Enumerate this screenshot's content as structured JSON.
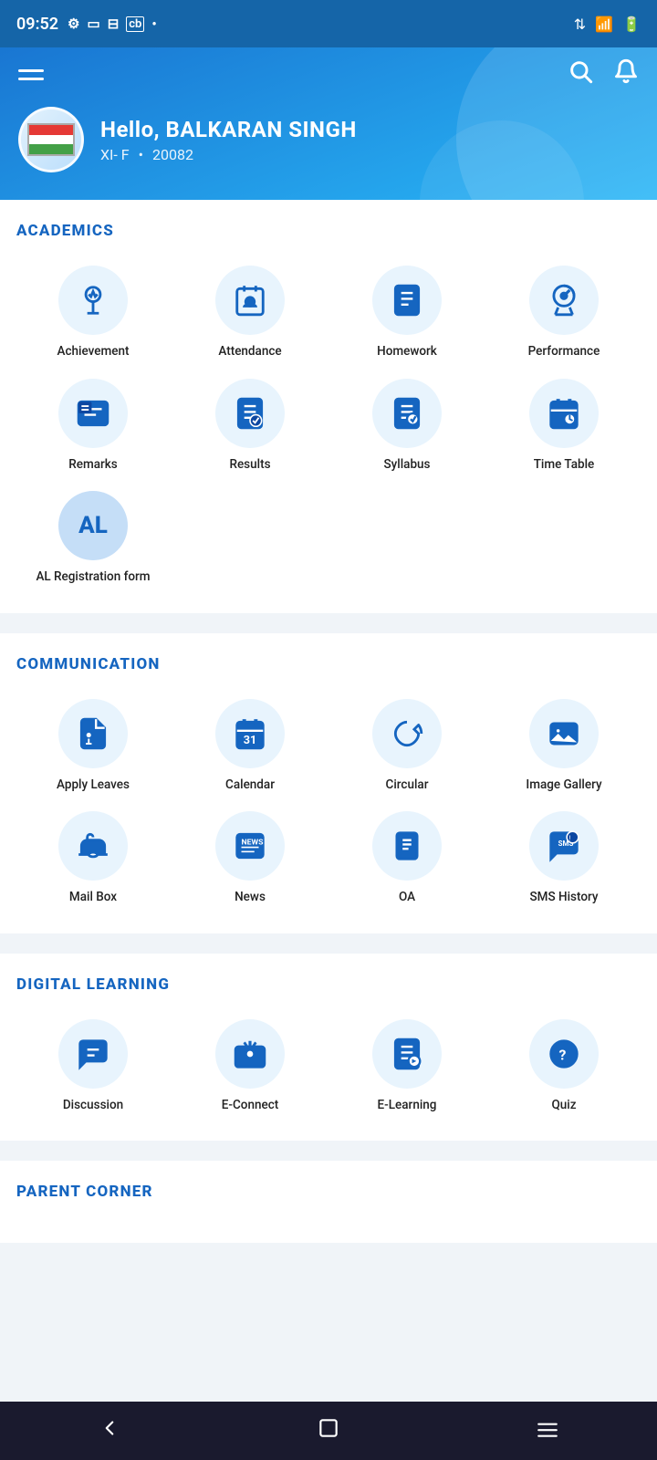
{
  "statusBar": {
    "time": "09:52",
    "leftIcons": [
      "gear",
      "screen-cast",
      "payment",
      "cb",
      "dot"
    ],
    "rightIcons": [
      "signal-up-down",
      "wifi",
      "battery"
    ]
  },
  "header": {
    "greeting": "Hello, BALKARAN SINGH",
    "class": "XI- F",
    "rollNo": "20082"
  },
  "sections": [
    {
      "id": "academics",
      "title": "ACADEMICS",
      "items": [
        {
          "id": "achievement",
          "label": "Achievement",
          "icon": "trophy"
        },
        {
          "id": "attendance",
          "label": "Attendance",
          "icon": "attendance"
        },
        {
          "id": "homework",
          "label": "Homework",
          "icon": "homework"
        },
        {
          "id": "performance",
          "label": "Performance",
          "icon": "performance"
        },
        {
          "id": "remarks",
          "label": "Remarks",
          "icon": "remarks"
        },
        {
          "id": "results",
          "label": "Results",
          "icon": "results"
        },
        {
          "id": "syllabus",
          "label": "Syllabus",
          "icon": "syllabus"
        },
        {
          "id": "timetable",
          "label": "Time Table",
          "icon": "timetable"
        },
        {
          "id": "al-registration",
          "label": "AL Registration form",
          "icon": "al",
          "isAL": true
        }
      ]
    },
    {
      "id": "communication",
      "title": "COMMUNICATION",
      "items": [
        {
          "id": "apply-leaves",
          "label": "Apply Leaves",
          "icon": "leaves"
        },
        {
          "id": "calendar",
          "label": "Calendar",
          "icon": "calendar"
        },
        {
          "id": "circular",
          "label": "Circular",
          "icon": "circular"
        },
        {
          "id": "image-gallery",
          "label": "Image Gallery",
          "icon": "gallery"
        },
        {
          "id": "mailbox",
          "label": "Mail Box",
          "icon": "mailbox"
        },
        {
          "id": "news",
          "label": "News",
          "icon": "news"
        },
        {
          "id": "oa",
          "label": "OA",
          "icon": "oa"
        },
        {
          "id": "sms-history",
          "label": "SMS History",
          "icon": "sms"
        }
      ]
    },
    {
      "id": "digital-learning",
      "title": "DIGITAL LEARNING",
      "items": [
        {
          "id": "discussion",
          "label": "Discussion",
          "icon": "discussion"
        },
        {
          "id": "e-connect",
          "label": "E-Connect",
          "icon": "econnect"
        },
        {
          "id": "e-learning",
          "label": "E-Learning",
          "icon": "elearning"
        },
        {
          "id": "quiz",
          "label": "Quiz",
          "icon": "quiz"
        }
      ]
    },
    {
      "id": "parent-corner",
      "title": "PARENT CORNER",
      "items": []
    }
  ],
  "bottomNav": {
    "buttons": [
      "back",
      "home",
      "menu"
    ]
  }
}
